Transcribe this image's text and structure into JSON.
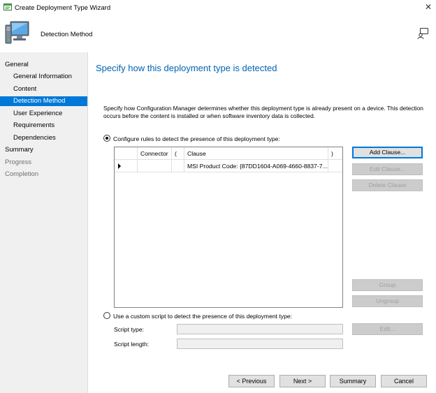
{
  "window": {
    "title": "Create Deployment Type Wizard",
    "close_glyph": "✕"
  },
  "banner": {
    "page_name": "Detection Method"
  },
  "nav": {
    "items": [
      {
        "label": "General",
        "level": 0,
        "state": "normal"
      },
      {
        "label": "General Information",
        "level": 1,
        "state": "normal"
      },
      {
        "label": "Content",
        "level": 1,
        "state": "normal"
      },
      {
        "label": "Detection Method",
        "level": 1,
        "state": "active"
      },
      {
        "label": "User Experience",
        "level": 1,
        "state": "normal"
      },
      {
        "label": "Requirements",
        "level": 1,
        "state": "normal"
      },
      {
        "label": "Dependencies",
        "level": 1,
        "state": "normal"
      },
      {
        "label": "Summary",
        "level": 0,
        "state": "normal"
      },
      {
        "label": "Progress",
        "level": 0,
        "state": "disabled"
      },
      {
        "label": "Completion",
        "level": 0,
        "state": "disabled"
      }
    ]
  },
  "content": {
    "heading": "Specify how this deployment type is detected",
    "description": "Specify how Configuration Manager determines whether this deployment type is already present on a device. This detection occurs before the content is installed or when software inventory data is collected.",
    "rules_radio_label": "Configure rules to detect the presence of this deployment type:",
    "rules_radio_checked": true,
    "script_radio_label": "Use a custom script to detect the presence of this deployment type:",
    "script_radio_checked": false
  },
  "grid": {
    "columns": [
      "Connector",
      "(",
      "Clause",
      ")"
    ],
    "rows": [
      {
        "connector": "",
        "open_paren": "",
        "clause": "MSI Product Code: {87DD1604-A069-4660-8837-7...",
        "close_paren": ""
      }
    ]
  },
  "side_buttons": {
    "add_clause": "Add Clause...",
    "edit_clause": "Edit Clause...",
    "delete_clause": "Delete Clause",
    "group": "Group",
    "ungroup": "Ungroup",
    "edit": "Edit..."
  },
  "script": {
    "type_label": "Script type:",
    "type_value": "",
    "length_label": "Script length:",
    "length_value": ""
  },
  "footer": {
    "previous": "< Previous",
    "next": "Next >",
    "summary": "Summary",
    "cancel": "Cancel"
  }
}
